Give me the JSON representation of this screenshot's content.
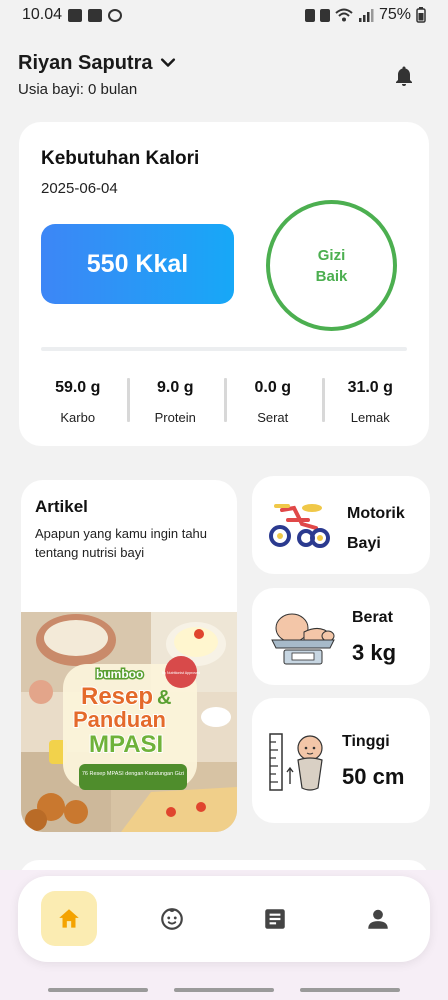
{
  "status_bar": {
    "time": "10.04",
    "battery": "75%"
  },
  "header": {
    "user_name": "Riyan Saputra",
    "baby_age": "Usia bayi: 0 bulan"
  },
  "calorie": {
    "title": "Kebutuhan Kalori",
    "date": "2025-06-04",
    "kcal": "550 Kkal",
    "status": "Gizi Baik",
    "status_color": "#4caf50",
    "macros": [
      {
        "value": "59.0 g",
        "label": "Karbo"
      },
      {
        "value": "9.0 g",
        "label": "Protein"
      },
      {
        "value": "0.0 g",
        "label": "Serat"
      },
      {
        "value": "31.0 g",
        "label": "Lemak"
      }
    ]
  },
  "article": {
    "title": "Artikel",
    "description": "Apapun yang kamu ingin tahu tentang nutrisi bayi",
    "image": {
      "brand": "bumboo",
      "title_line1": "Resep",
      "title_amp": "&",
      "title_line2": "Panduan",
      "title_line3": "MPASI",
      "ribbon": "76 Resep MPASI dengan Kandungan Gizi",
      "badge": "By Nutritionist Approved"
    }
  },
  "metrics": {
    "motorik": {
      "label": "Motorik Bayi",
      "icon": "tricycle-icon"
    },
    "berat": {
      "label": "Berat",
      "value": "3 kg",
      "icon": "baby-scale-icon"
    },
    "tinggi": {
      "label": "Tinggi",
      "value": "50 cm",
      "icon": "baby-height-icon"
    }
  },
  "nav": {
    "items": [
      {
        "name": "home",
        "icon": "home-icon",
        "active": true
      },
      {
        "name": "baby",
        "icon": "baby-face-icon",
        "active": false
      },
      {
        "name": "article",
        "icon": "article-icon",
        "active": false
      },
      {
        "name": "profile",
        "icon": "person-icon",
        "active": false
      }
    ],
    "active_color": "#fbecb2"
  }
}
